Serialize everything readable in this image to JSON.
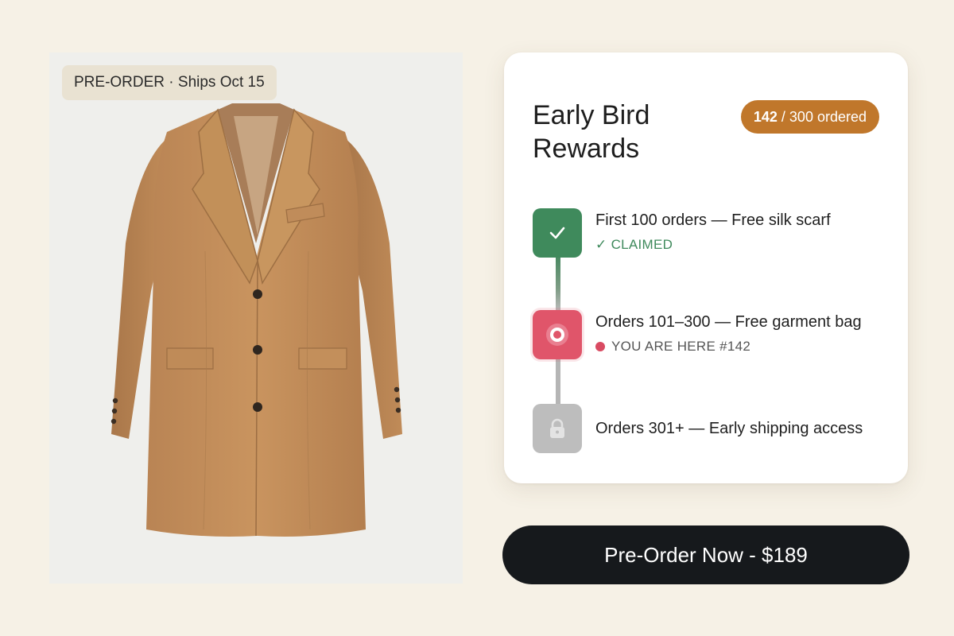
{
  "product": {
    "badge": "PRE-ORDER · Ships Oct 15",
    "image_icon": "camel-overcoat"
  },
  "rewards": {
    "title": "Early Bird Rewards",
    "progress": {
      "count": "142",
      "separator_total": " / 300 ordered",
      "ordered": 142,
      "total": 300
    },
    "tiers": [
      {
        "title": "First 100 orders — Free silk scarf",
        "status": "✓ CLAIMED",
        "state": "claimed",
        "icon": "checkmark-icon",
        "color": "#3f8a5c"
      },
      {
        "title": "Orders 101–300 — Free garment bag",
        "status": "YOU ARE HERE #142",
        "state": "current",
        "icon": "target-icon",
        "color": "#e0556a"
      },
      {
        "title": "Orders 301+ — Early shipping access",
        "status": "",
        "state": "locked",
        "icon": "lock-icon",
        "color": "#bdbdbd"
      }
    ]
  },
  "cta": {
    "label": "Pre-Order Now - $189"
  },
  "colors": {
    "background": "#f6f1e6",
    "accent": "#c0772b",
    "claimed": "#3f8a5c",
    "current": "#e0556a",
    "button": "#16191c"
  }
}
